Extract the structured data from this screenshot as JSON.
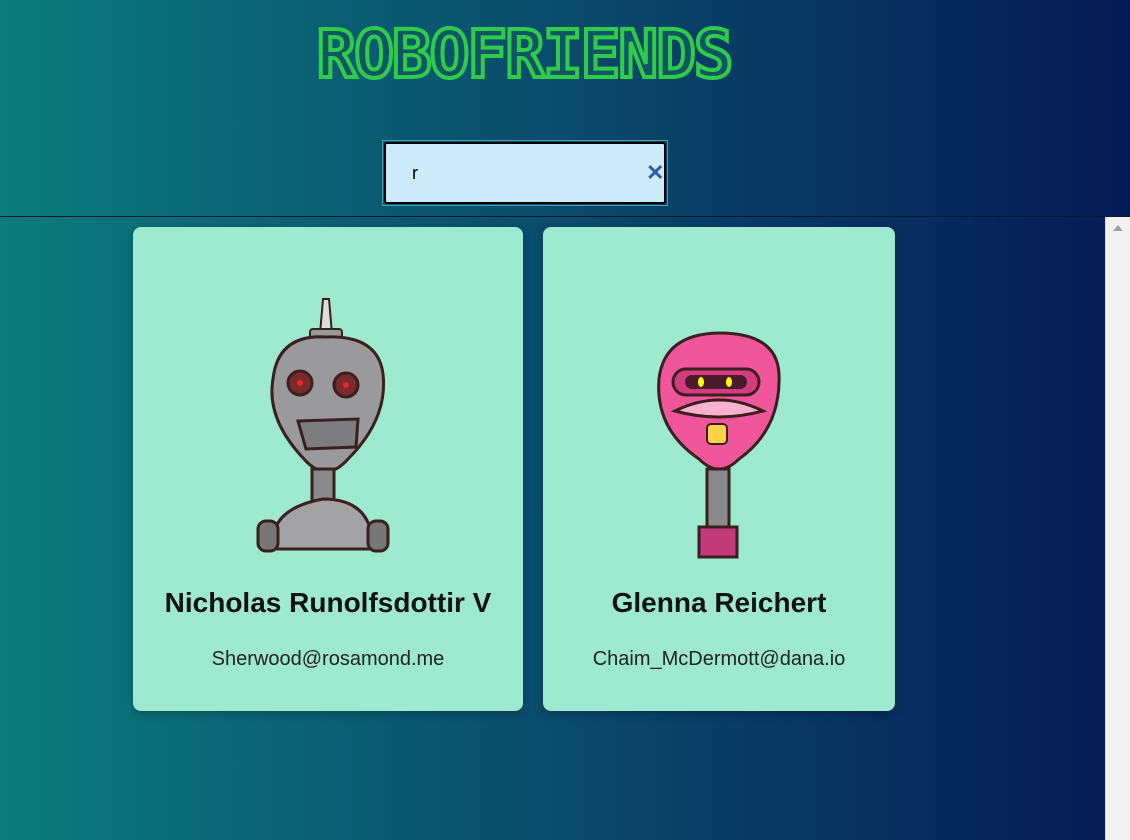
{
  "app": {
    "title": "ROBOFRIENDS"
  },
  "search": {
    "value": "r",
    "clear_icon": "✕"
  },
  "robots": [
    {
      "name": "Nicholas Runolfsdottir V",
      "email": "Sherwood@rosamond.me",
      "color": "#9a9a9c"
    },
    {
      "name": "Glenna Reichert",
      "email": "Chaim_McDermott@dana.io",
      "color": "#f0579a"
    }
  ],
  "colors": {
    "card": "#9eead0",
    "title": "#2ecc48",
    "search_bg": "#cdebfb"
  }
}
